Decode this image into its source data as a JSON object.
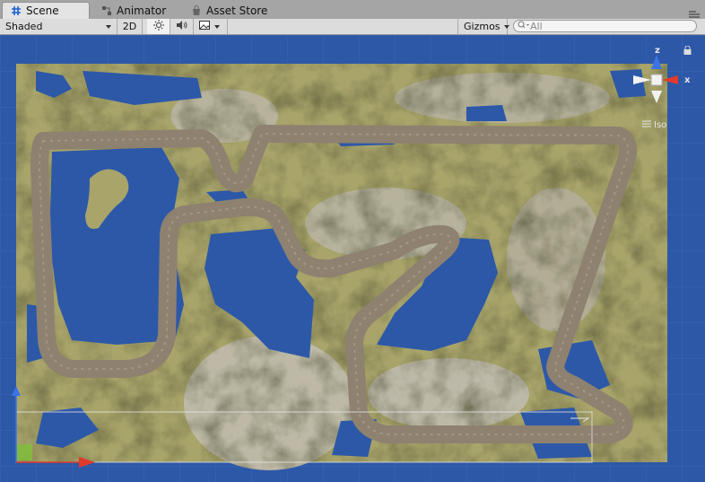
{
  "tabs": [
    {
      "label": "Scene",
      "icon": "grid-icon",
      "active": true
    },
    {
      "label": "Animator",
      "icon": "animator-icon",
      "active": false
    },
    {
      "label": "Asset Store",
      "icon": "store-icon",
      "active": false
    }
  ],
  "toolbar": {
    "draw_mode": "Shaded",
    "mode_2d": "2D",
    "lighting_icon": "sun-icon",
    "audio_icon": "speaker-icon",
    "effects_icon": "image-icon",
    "gizmos": "Gizmos",
    "search_placeholder": "All"
  },
  "gizmo": {
    "axis_y": "z",
    "axis_x": "x",
    "projection": "Iso"
  },
  "colors": {
    "water": "#2d58a8",
    "track": "#8e8170",
    "terrain": "#a8a46a",
    "axis_red": "#e03a2a",
    "axis_blue": "#3a74e8"
  }
}
